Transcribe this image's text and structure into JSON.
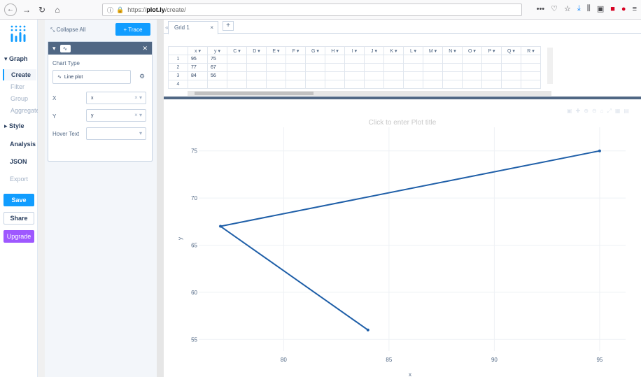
{
  "browser": {
    "back": "←",
    "forward": "→",
    "reload": "↻",
    "home": "⌂",
    "url_prefix": "https://",
    "url_host": "plot.ly",
    "url_path": "/create/"
  },
  "rail": {
    "graph": "Graph",
    "create": "Create",
    "filter": "Filter",
    "group": "Group",
    "aggregate": "Aggregate",
    "style": "Style",
    "analysis": "Analysis",
    "json": "JSON",
    "export": "Export",
    "save": "Save",
    "share": "Share",
    "upgrade": "Upgrade"
  },
  "panel": {
    "collapse_all": "Collapse All",
    "add_trace": "+ Trace",
    "chart_type_label": "Chart Type",
    "chart_type_value": "Line plot",
    "x_label": "X",
    "x_value": "x",
    "y_label": "Y",
    "y_value": "y",
    "hover_label": "Hover Text",
    "hover_value": ""
  },
  "grid": {
    "tab_name": "Grid 1",
    "tab_add": "+",
    "columns": [
      "x",
      "y",
      "C",
      "D",
      "E",
      "F",
      "G",
      "H",
      "I",
      "J",
      "K",
      "L",
      "M",
      "N",
      "O",
      "P",
      "Q",
      "R"
    ],
    "rows": [
      [
        "1",
        "95",
        "75"
      ],
      [
        "2",
        "77",
        "67"
      ],
      [
        "3",
        "84",
        "56"
      ],
      [
        "4",
        "",
        ""
      ]
    ]
  },
  "plot": {
    "title_placeholder": "Click to enter Plot title"
  },
  "chart_data": {
    "type": "line",
    "x": [
      95,
      77,
      84
    ],
    "series": [
      {
        "values": [
          75,
          67,
          56
        ]
      }
    ],
    "xlabel": "x",
    "ylabel": "y",
    "xlim": [
      76.3,
      95.9
    ],
    "ylim": [
      54.5,
      77.5
    ],
    "xticks": [
      80,
      85,
      90,
      95
    ],
    "yticks": [
      55,
      60,
      65,
      70,
      75
    ],
    "grid": true,
    "line_color": "#1f5fa8"
  }
}
